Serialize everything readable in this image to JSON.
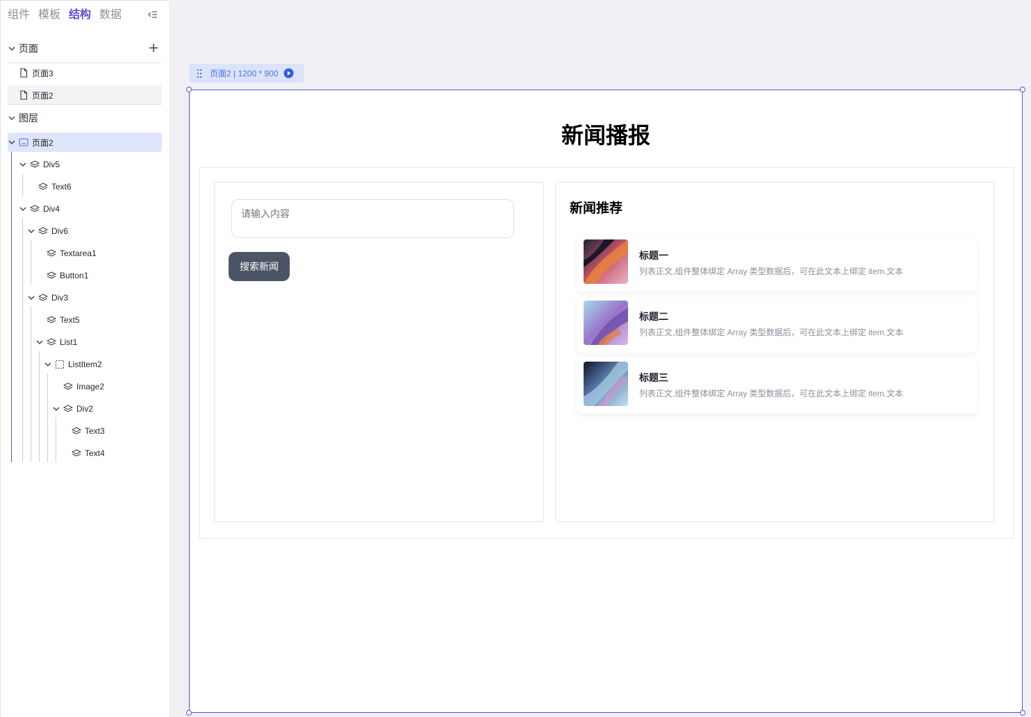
{
  "left_panel": {
    "tabs": [
      {
        "label": "组件"
      },
      {
        "label": "模板"
      },
      {
        "label": "结构"
      },
      {
        "label": "数据"
      }
    ],
    "active_tab": "结构",
    "pages_section": {
      "label": "页面",
      "items": [
        {
          "label": "页面3"
        },
        {
          "label": "页面2"
        }
      ]
    },
    "layers_section": {
      "label": "图层",
      "tree": [
        {
          "label": "页面2"
        },
        {
          "label": "Div5"
        },
        {
          "label": "Text6"
        },
        {
          "label": "Div4"
        },
        {
          "label": "Div6"
        },
        {
          "label": "Textarea1"
        },
        {
          "label": "Button1"
        },
        {
          "label": "Div3"
        },
        {
          "label": "Text5"
        },
        {
          "label": "List1"
        },
        {
          "label": "ListItem2"
        },
        {
          "label": "Image2"
        },
        {
          "label": "Div2"
        },
        {
          "label": "Text3"
        },
        {
          "label": "Text4"
        }
      ]
    }
  },
  "canvas": {
    "page_tag": "页面2 | 1200 * 900",
    "title": "新闻播报",
    "search": {
      "placeholder": "请输入内容",
      "button_label": "搜索新闻"
    },
    "recommend": {
      "title": "新闻推荐",
      "items": [
        {
          "title": "标题一",
          "desc": "列表正文,组件整体绑定 Array 类型数据后，可在此文本上绑定 item.文本"
        },
        {
          "title": "标题二",
          "desc": "列表正文,组件整体绑定 Array 类型数据后，可在此文本上绑定 item.文本"
        },
        {
          "title": "标题三",
          "desc": "列表正文,组件整体绑定 Array 类型数据后，可在此文本上绑定 item.文本"
        }
      ]
    }
  },
  "colors": {
    "accent": "#5b4fd9",
    "selected_row": "#dfe5fb",
    "button": "#4b5565",
    "page_tag": "#4e73df"
  },
  "icons": [
    "collapse-icon",
    "chevron-down-icon",
    "plus-icon",
    "file-icon",
    "page-icon",
    "layers-icon",
    "dashed-box-icon",
    "drag-handle-icon",
    "play-icon"
  ]
}
